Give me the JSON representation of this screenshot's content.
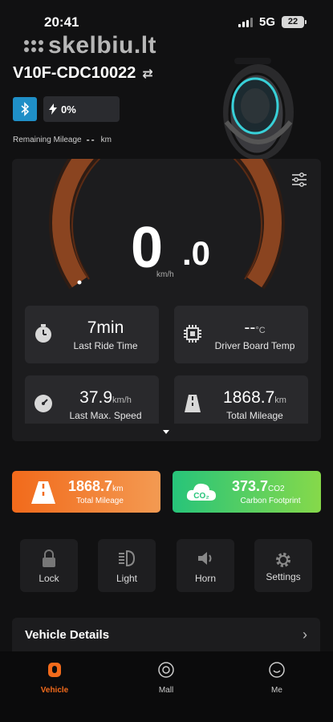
{
  "status_bar": {
    "time": "20:41",
    "network": "5G",
    "battery": "22"
  },
  "watermark": "skelbiu.lt",
  "header": {
    "device_name": "V10F-CDC10022",
    "battery_percent": "0%",
    "remaining_label": "Remaining Mileage",
    "remaining_value": "--",
    "remaining_unit": "km"
  },
  "gauge": {
    "speed_int": "0",
    "speed_dec": ".0",
    "unit": "km/h",
    "level": 0
  },
  "stats": [
    {
      "value": "7min",
      "unit": "",
      "label": "Last Ride Time",
      "icon": "stopwatch-icon"
    },
    {
      "value": "--",
      "unit": "°C",
      "label": "Driver Board Temp",
      "icon": "chip-icon"
    },
    {
      "value": "37.9",
      "unit": "km/h",
      "label": "Last Max. Speed",
      "icon": "speedometer-icon"
    },
    {
      "value": "1868.7",
      "unit": "km",
      "label": "Total Mileage",
      "icon": "road-icon"
    }
  ],
  "summary": {
    "mileage": {
      "value": "1868.7",
      "unit": "km",
      "label": "Total Mileage",
      "color": "#f26a1b"
    },
    "carbon": {
      "value": "373.7",
      "unit": "CO2",
      "label": "Carbon Footprint",
      "color": "#27c47a"
    }
  },
  "controls": [
    {
      "label": "Lock",
      "icon": "lock-icon"
    },
    {
      "label": "Light",
      "icon": "headlight-icon"
    },
    {
      "label": "Horn",
      "icon": "horn-icon"
    },
    {
      "label": "Settings",
      "icon": "gear-icon"
    }
  ],
  "vehicle_details": {
    "title": "Vehicle Details"
  },
  "nav": [
    {
      "label": "Vehicle",
      "icon": "vehicle-icon",
      "active": true
    },
    {
      "label": "Mall",
      "icon": "mall-icon",
      "active": false
    },
    {
      "label": "Me",
      "icon": "me-icon",
      "active": false
    }
  ],
  "colors": {
    "accent": "#f26a1b",
    "gauge_track": "#7a3a1a",
    "bluetooth": "#1f8fc7"
  }
}
